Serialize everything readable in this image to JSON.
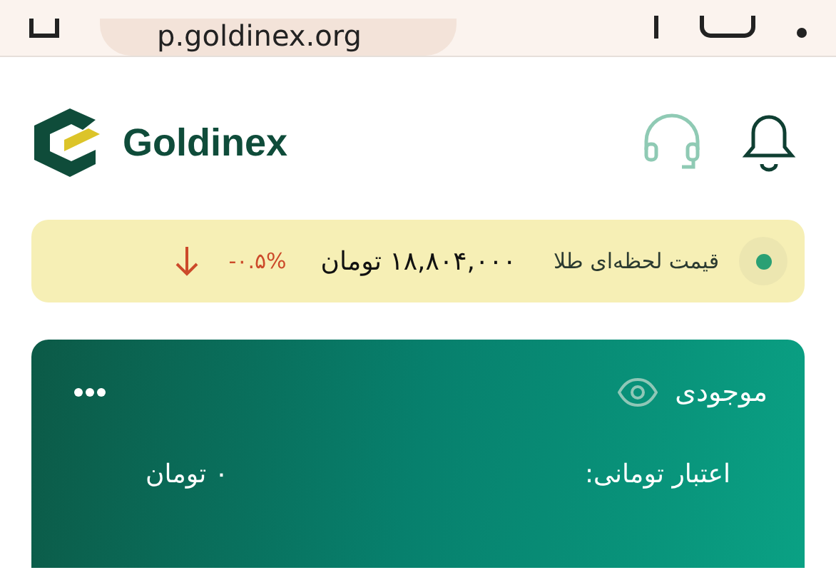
{
  "browser": {
    "url": "p.goldinex.org"
  },
  "header": {
    "brand": "Goldinex"
  },
  "ticker": {
    "label": "قیمت لحظه‌ای طلا",
    "price": "۱۸,۸۰۴,۰۰۰ تومان",
    "change": "-۰.۵%",
    "falling": true
  },
  "wallet": {
    "title": "موجودی",
    "credit_label": "اعتبار تومانی:",
    "credit_value": "۰ تومان"
  }
}
